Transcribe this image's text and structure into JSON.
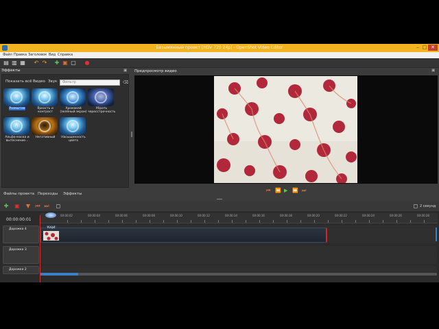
{
  "window": {
    "title": "Безымянный проект [HDV 720 24p] - OpenShot Video Editor"
  },
  "menu": {
    "items": [
      "Файл",
      "Правка",
      "Заголовок",
      "Вид",
      "Справка"
    ]
  },
  "effects": {
    "panel_title": "Эффекты",
    "tabs": [
      "Показать всё",
      "Видео",
      "Звук"
    ],
    "filter_placeholder": "Фильтр",
    "items": [
      {
        "label": "Размытие",
        "selected": true
      },
      {
        "label": "Яркость и контраст",
        "selected": false
      },
      {
        "label": "Хромакей (зелёный экран)",
        "selected": false
      },
      {
        "label": "Убрать чересстрочность",
        "selected": false
      },
      {
        "label": "Альфа-маска и вытеснениe...",
        "selected": false
      },
      {
        "label": "Негативный",
        "selected": false
      },
      {
        "label": "Насыщенность цвета",
        "selected": false
      }
    ]
  },
  "preview": {
    "panel_title": "Предпросмотр видео"
  },
  "bottom_tabs": [
    "Файлы проекта",
    "Переходы",
    "Эффекты"
  ],
  "timeline": {
    "timecode": "00:00:00:01",
    "zoom_label": "2 секунд",
    "ruler_labels": [
      "00:00:02",
      "00:00:04",
      "00:00:06",
      "00:00:08",
      "00:00:10",
      "00:00:12",
      "00:00:14",
      "00:00:16",
      "00:00:18",
      "00:00:20",
      "00:00:22",
      "00:00:24",
      "00:00:26",
      "00:00:28"
    ],
    "tracks": [
      "Дорожка 4",
      "Дорожка 3",
      "Дорожка 2"
    ],
    "clip_label": "Клip4"
  },
  "colors": {
    "titlebar": "#f2b320",
    "selection": "#2f6fd3",
    "playhead": "#d83030"
  }
}
